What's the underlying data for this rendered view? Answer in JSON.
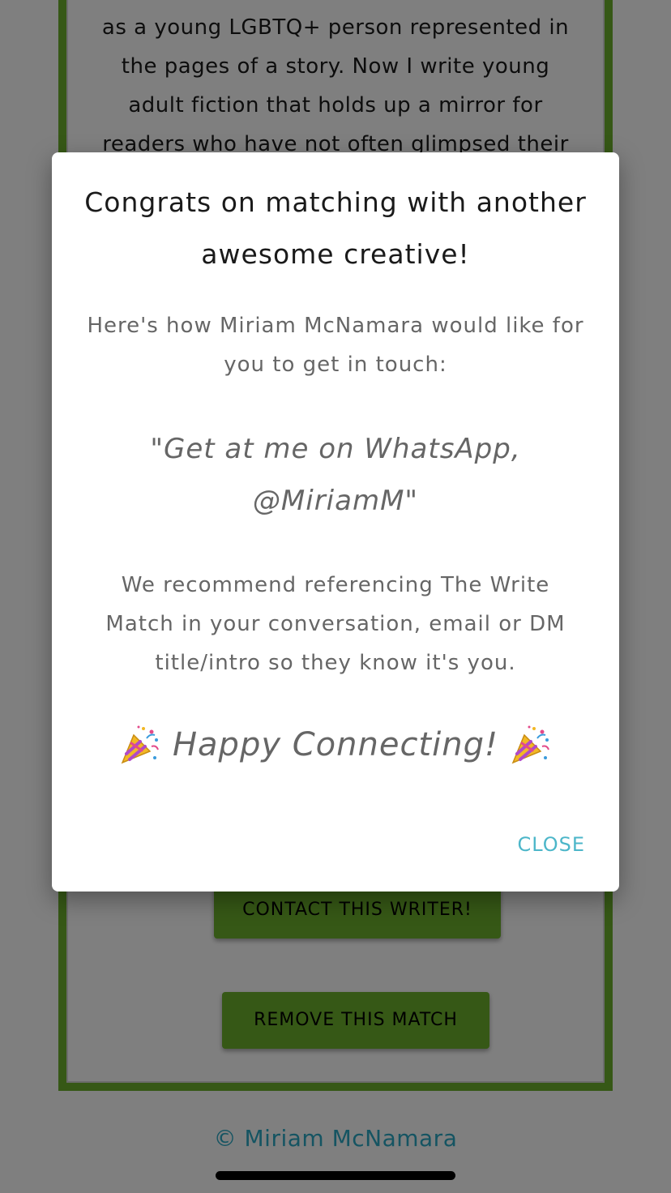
{
  "background": {
    "bio_text": "as a young LGBTQ+ person represented in the pages of a story. Now I write young adult fiction that holds up a mirror for readers who have not often glimpsed their",
    "contact_button_label": "CONTACT THIS WRITER!",
    "remove_button_label": "REMOVE THIS MATCH",
    "footer_text": "© Miriam McNamara"
  },
  "dialog": {
    "title": "Congrats on matching with another awesome creative!",
    "intro": "Here's how Miriam McNamara would like for you to get in touch:",
    "quote": "\"Get at me on WhatsApp, @MiriamM\"",
    "recommendation": "We recommend referencing The Write Match in your conversation, email or DM title/intro so they know it's you.",
    "happy_text": "Happy Connecting!",
    "party_icon": "party-popper-icon",
    "close_label": "CLOSE"
  },
  "colors": {
    "brand_green": "#6cb02c",
    "link_teal": "#2aa9c4",
    "close_teal": "#4cb6c9"
  }
}
